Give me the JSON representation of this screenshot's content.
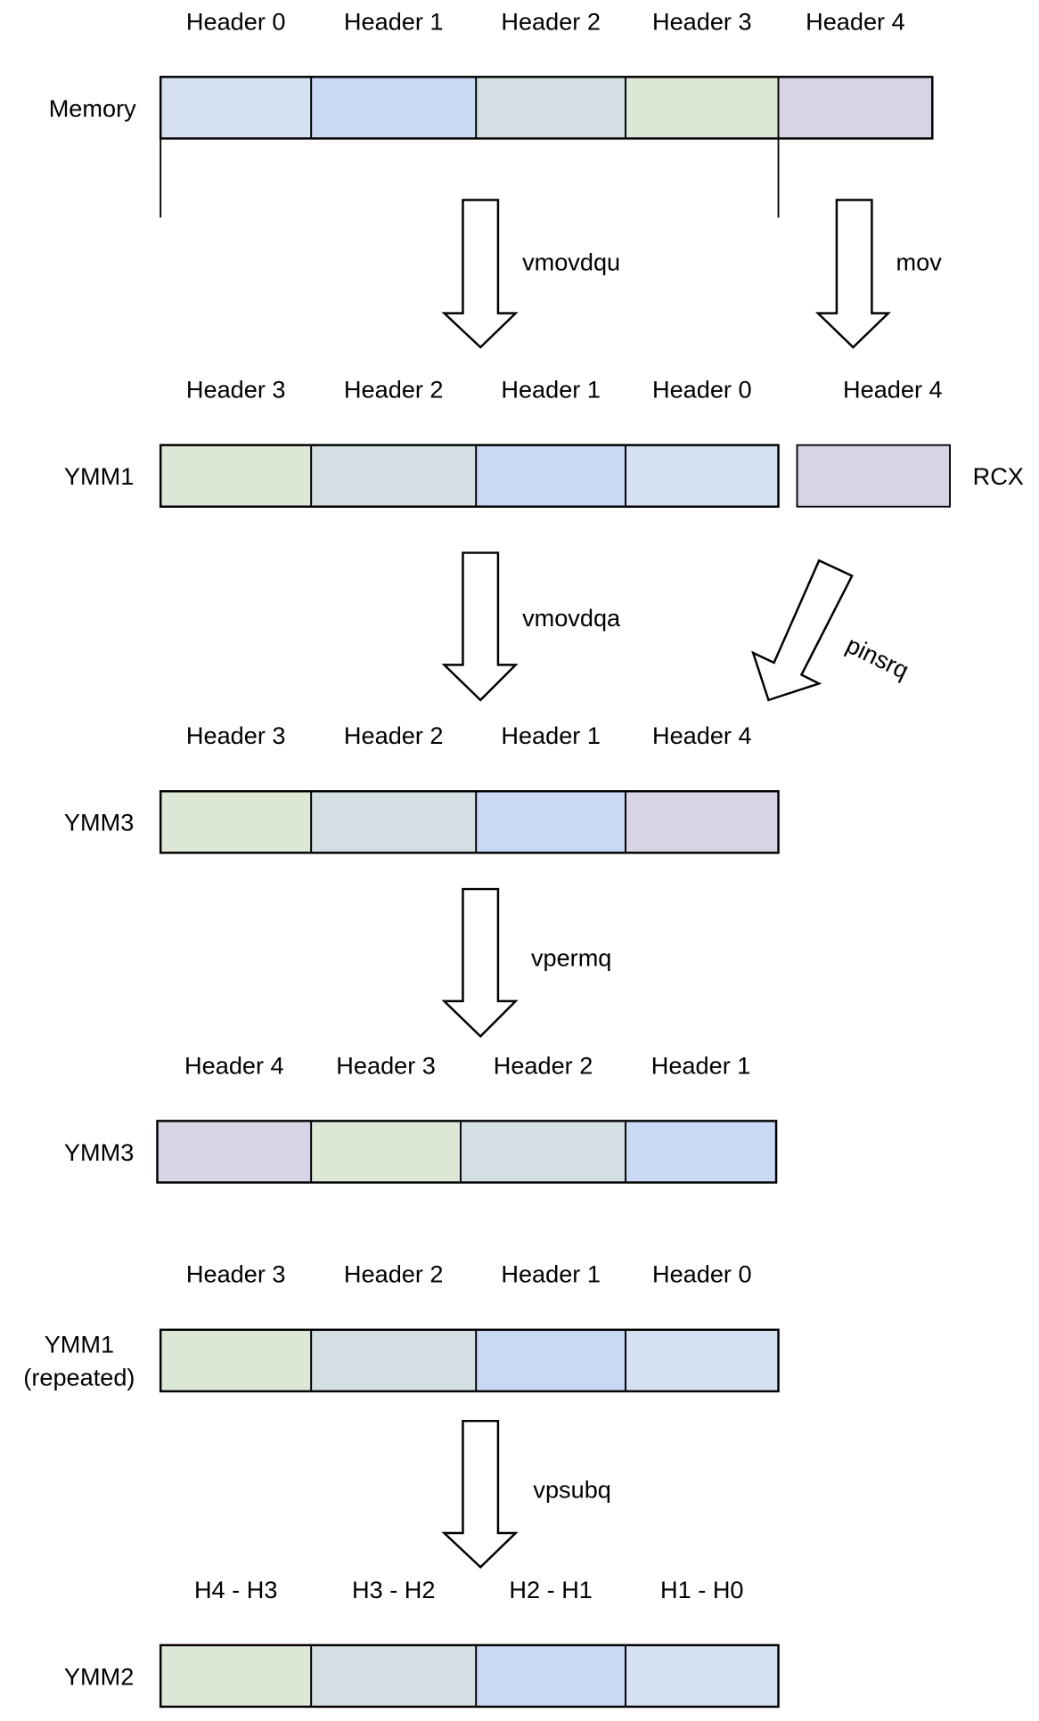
{
  "colors": {
    "light_blue": "#d5e1f0",
    "blue": "#c9d8f3",
    "gray_blue": "#d3dfe3",
    "green": "#dce8d5",
    "purple": "#d8d3e5"
  },
  "rows": [
    {
      "label": [
        "Memory"
      ],
      "cells": [
        {
          "header": "Header 0",
          "color": "light_blue"
        },
        {
          "header": "Header 1",
          "color": "blue"
        },
        {
          "header": "Header 2",
          "color": "gray_blue"
        },
        {
          "header": "Header 3",
          "color": "green"
        },
        {
          "header": "Header 4",
          "color": "purple"
        }
      ]
    },
    {
      "label": [
        "YMM1"
      ],
      "cells": [
        {
          "header": "Header 3",
          "color": "green"
        },
        {
          "header": "Header 2",
          "color": "gray_blue"
        },
        {
          "header": "Header 1",
          "color": "blue"
        },
        {
          "header": "Header 0",
          "color": "light_blue"
        }
      ],
      "side_register": {
        "label": "RCX",
        "header": "Header 4",
        "color": "purple"
      }
    },
    {
      "label": [
        "YMM3"
      ],
      "cells": [
        {
          "header": "Header 3",
          "color": "green"
        },
        {
          "header": "Header 2",
          "color": "gray_blue"
        },
        {
          "header": "Header 1",
          "color": "blue"
        },
        {
          "header": "Header 4",
          "color": "purple"
        }
      ]
    },
    {
      "label": [
        "YMM3"
      ],
      "cells": [
        {
          "header": "Header 4",
          "color": "purple"
        },
        {
          "header": "Header 3",
          "color": "green"
        },
        {
          "header": "Header 2",
          "color": "gray_blue"
        },
        {
          "header": "Header 1",
          "color": "blue"
        }
      ]
    },
    {
      "label": [
        "YMM1",
        "(repeated)"
      ],
      "cells": [
        {
          "header": "Header 3",
          "color": "green"
        },
        {
          "header": "Header 2",
          "color": "gray_blue"
        },
        {
          "header": "Header 1",
          "color": "blue"
        },
        {
          "header": "Header 0",
          "color": "light_blue"
        }
      ]
    },
    {
      "label": [
        "YMM2"
      ],
      "cells": [
        {
          "header": "H4 - H3",
          "color": "green"
        },
        {
          "header": "H3 - H2",
          "color": "gray_blue"
        },
        {
          "header": "H2 - H1",
          "color": "blue"
        },
        {
          "header": "H1 - H0",
          "color": "light_blue"
        }
      ]
    }
  ],
  "operations": {
    "vmovdqu": "vmovdqu",
    "mov": "mov",
    "vmovdqa": "vmovdqa",
    "pinsrq": "pinsrq",
    "vpermq": "vpermq",
    "vpsubq": "vpsubq"
  }
}
